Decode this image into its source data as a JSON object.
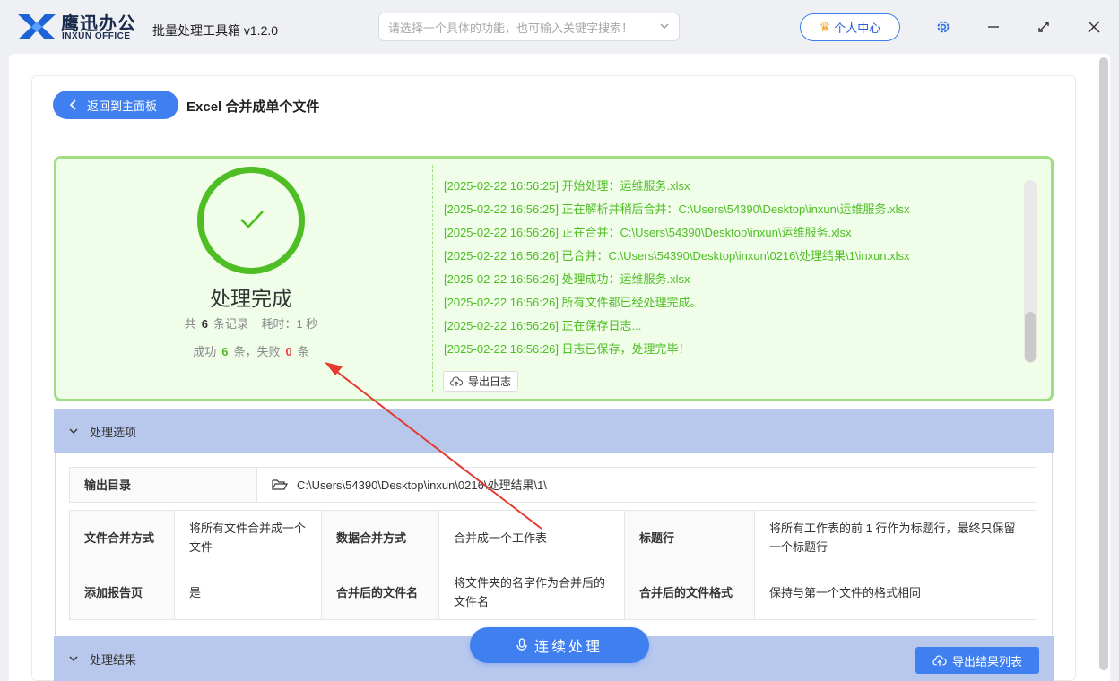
{
  "app": {
    "brand_cn": "鹰迅办公",
    "brand_en": "INXUN OFFICE",
    "title": "批量处理工具箱 v1.2.0",
    "search_placeholder": "请选择一个具体的功能，也可输入关键字搜索！",
    "user_center": "个人中心"
  },
  "header": {
    "back_label": "返回到主面板",
    "page_title": "Excel 合并成单个文件"
  },
  "result": {
    "status": "处理完成",
    "total_prefix": "共",
    "total": "6",
    "total_suffix": "条记录",
    "time_label": "耗时：1 秒",
    "success_prefix": "成功",
    "success": "6",
    "fail_mid": "条，失败",
    "fail": "0",
    "fail_suffix": "条",
    "log": [
      "[2025-02-22 16:56:25] 开始处理：运维服务.xlsx",
      "[2025-02-22 16:56:25] 正在解析并稍后合并：C:\\Users\\54390\\Desktop\\inxun\\运维服务.xlsx",
      "[2025-02-22 16:56:26] 正在合并：C:\\Users\\54390\\Desktop\\inxun\\运维服务.xlsx",
      "[2025-02-22 16:56:26] 已合并：C:\\Users\\54390\\Desktop\\inxun\\0216\\处理结果\\1\\inxun.xlsx",
      "[2025-02-22 16:56:26] 处理成功：运维服务.xlsx",
      "[2025-02-22 16:56:26] 所有文件都已经处理完成。",
      "[2025-02-22 16:56:26] 正在保存日志...",
      "[2025-02-22 16:56:26] 日志已保存，处理完毕！"
    ],
    "export_log": "导出日志"
  },
  "options": {
    "section_title": "处理选项",
    "output_dir_label": "输出目录",
    "output_dir_value": "C:\\Users\\54390\\Desktop\\inxun\\0216\\处理结果\\1\\",
    "merge_mode_label": "文件合并方式",
    "merge_mode_value": "将所有文件合并成一个文件",
    "data_merge_label": "数据合并方式",
    "data_merge_value": "合并成一个工作表",
    "header_row_label": "标题行",
    "header_row_value": "将所有工作表的前 1 行作为标题行，最终只保留一个标题行",
    "report_page_label": "添加报告页",
    "report_page_value": "是",
    "merged_name_label": "合并后的文件名",
    "merged_name_value": "将文件夹的名字作为合并后的文件名",
    "merged_format_label": "合并后的文件格式",
    "merged_format_value": "保持与第一个文件的格式相同"
  },
  "results_section": {
    "title": "处理结果",
    "export_list": "导出结果列表"
  },
  "continue_button": "连续处理",
  "colors": {
    "primary": "#3f7ff0",
    "success": "#4fbe24",
    "fail": "#f23c3c",
    "section_header": "#b8c8ec",
    "result_bg": "#effde9",
    "annotation_arrow": "#e53a2f"
  }
}
